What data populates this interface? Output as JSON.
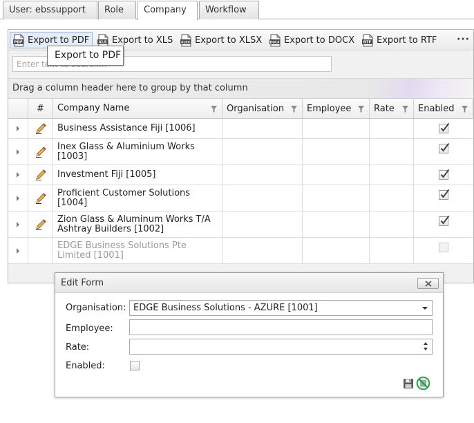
{
  "tabs": [
    {
      "label": "User: ebssupport",
      "active": false
    },
    {
      "label": "Role",
      "active": false
    },
    {
      "label": "Company",
      "active": true
    },
    {
      "label": "Workflow",
      "active": false
    }
  ],
  "toolbar": {
    "export_pdf": "Export to PDF",
    "export_xls": "Export to XLS",
    "export_xlsx": "Export to XLSX",
    "export_docx": "Export to DOCX",
    "export_rtf": "Export to RTF",
    "more": "···",
    "icons": {
      "pdf": "PDF",
      "xls": "XLS",
      "xlsx": "XLSX",
      "docx": "DOCX",
      "rtf": "RTF"
    }
  },
  "tooltip": {
    "text": "Export to PDF"
  },
  "search": {
    "placeholder": "Enter text to search...",
    "value": ""
  },
  "group_panel": {
    "text": "Drag a column header here to group by that column"
  },
  "grid": {
    "columns": {
      "index": "#",
      "company_name": "Company Name",
      "organisation": "Organisation",
      "employee": "Employee",
      "rate": "Rate",
      "enabled": "Enabled"
    },
    "rows": [
      {
        "company_line1": "Business Assistance Fiji [1006]",
        "company_line2": "",
        "organisation": "",
        "employee": "",
        "rate": "",
        "enabled": true,
        "editable": true
      },
      {
        "company_line1": "Inex Glass & Aluminium Works",
        "company_line2": "[1003]",
        "organisation": "",
        "employee": "",
        "rate": "",
        "enabled": true,
        "editable": true
      },
      {
        "company_line1": "Investment Fiji [1005]",
        "company_line2": "",
        "organisation": "",
        "employee": "",
        "rate": "",
        "enabled": true,
        "editable": true
      },
      {
        "company_line1": "Proficient Customer Solutions",
        "company_line2": "[1004]",
        "organisation": "",
        "employee": "",
        "rate": "",
        "enabled": true,
        "editable": true
      },
      {
        "company_line1": "Zion Glass & Aluminum Works T/A",
        "company_line2": "Ashtray Builders [1002]",
        "organisation": "",
        "employee": "",
        "rate": "",
        "enabled": true,
        "editable": true
      },
      {
        "company_line1": "EDGE Business Solutions Pte",
        "company_line2": "Limited [1001]",
        "organisation": "",
        "employee": "",
        "rate": "",
        "enabled": false,
        "editable": false
      }
    ]
  },
  "edit_form": {
    "title": "Edit Form",
    "organisation_label": "Organisation:",
    "organisation_value": "EDGE Business Solutions - AZURE [1001]",
    "employee_label": "Employee:",
    "employee_value": "",
    "rate_label": "Rate:",
    "rate_value": "",
    "enabled_label": "Enabled:",
    "enabled_value": false
  },
  "colors": {
    "accent": "#9db3d1",
    "check": "#444444",
    "cancel_green": "#27a045"
  }
}
